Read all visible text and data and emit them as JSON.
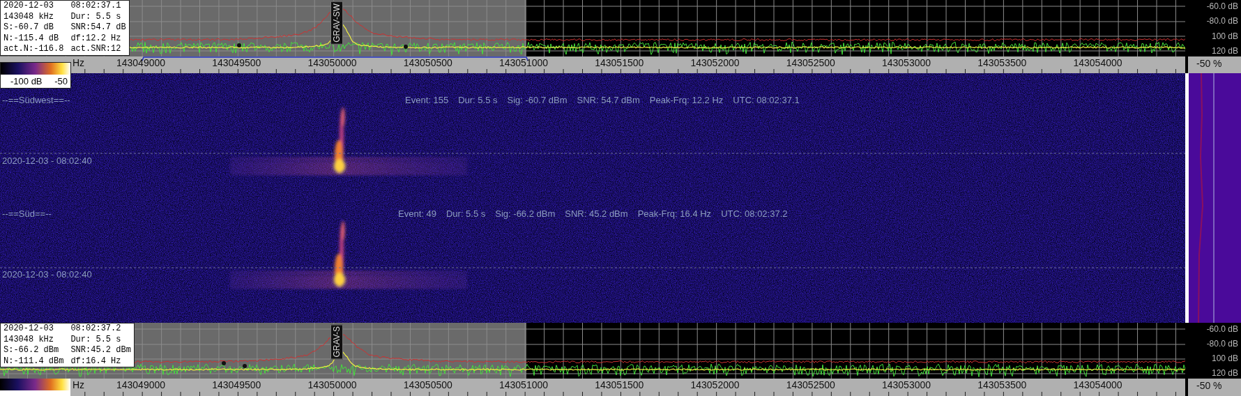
{
  "top_panel": {
    "info": [
      [
        "2020-12-03",
        "08:02:37.1"
      ],
      [
        "143048 kHz",
        "Dur: 5.5 s"
      ],
      [
        "S:-60.7 dB",
        "SNR:54.7 dB"
      ],
      [
        "N:-115.4 dB",
        "df:12.2 Hz"
      ],
      [
        "act.N:-116.8",
        "act.SNR:12"
      ]
    ],
    "marker_label": "GRAV-SW",
    "db_labels": [
      "-60.0 dB",
      "-80.0 dB",
      "100 dB",
      "120 dB"
    ],
    "axis_unit": "Hz",
    "axis_ticks": [
      "143049000",
      "143049500",
      "143050000",
      "143050500",
      "143051000",
      "143051500",
      "143052000",
      "143052500",
      "143053000",
      "143053500",
      "143054000"
    ],
    "percent": "-50 %",
    "colorbar": {
      "min": "-100 dB",
      "max": "-50"
    }
  },
  "waterfall": {
    "channels": [
      {
        "name": "--==Südwest==--",
        "event": [
          "Event: 155",
          "Dur: 5.5 s",
          "Sig: -60.7 dBm",
          "SNR: 54.7 dBm",
          "Peak-Frq: 12.2 Hz",
          "UTC: 08:02:37.1"
        ],
        "timestamp": "2020-12-03 - 08:02:40"
      },
      {
        "name": "--==Süd==--",
        "event": [
          "Event: 49",
          "Dur: 5.5 s",
          "Sig: -66.2 dBm",
          "SNR: 45.2 dBm",
          "Peak-Frq: 16.4 Hz",
          "UTC: 08:02:37.2"
        ],
        "timestamp": "2020-12-03 - 08:02:40"
      }
    ]
  },
  "bottom_panel": {
    "info": [
      [
        "2020-12-03",
        "08:02:37.2"
      ],
      [
        "143048 kHz",
        "Dur: 5.5 s"
      ],
      [
        "S:-66.2 dBm",
        "SNR:45.2 dBm"
      ],
      [
        "N:-111.4 dBm",
        "df:16.4 Hz"
      ]
    ],
    "marker_label": "GRAV-S",
    "db_labels": [
      "-60.0 dB",
      "-80.0 dB",
      "100 dB",
      "120 dB"
    ],
    "axis_unit": "Hz",
    "axis_ticks": [
      "143049000",
      "143049500",
      "143050000",
      "143050500",
      "143051000",
      "143051500",
      "143052000",
      "143052500",
      "143053000",
      "143053500",
      "143054000"
    ],
    "percent": "-50 %"
  }
}
